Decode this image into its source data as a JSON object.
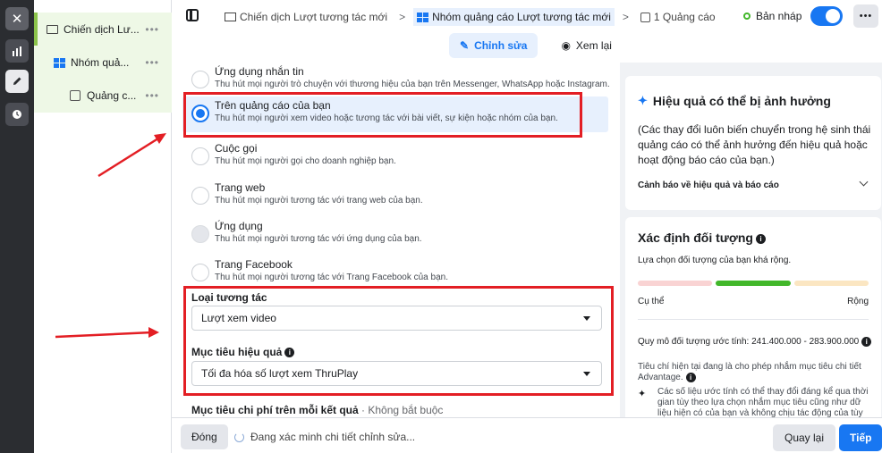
{
  "rail": {
    "close_glyph": "✕"
  },
  "tree": [
    {
      "label": "Chiến dịch Lư...",
      "more": "•••"
    },
    {
      "label": "Nhóm quả...",
      "more": "•••"
    },
    {
      "label": "Quảng c...",
      "more": "•••"
    }
  ],
  "header": {
    "crumbs": [
      "Chiến dịch Lượt tương tác mới",
      "Nhóm quảng cáo Lượt tương tác mới",
      "1 Quảng cáo"
    ],
    "separator": ">",
    "status": "Bản nháp",
    "more": "•••"
  },
  "tabs": [
    {
      "label": "Chỉnh sửa",
      "icon": "pencil-icon",
      "glyph": "✎"
    },
    {
      "label": "Xem lại",
      "icon": "eye-icon",
      "glyph": "◉"
    }
  ],
  "options": [
    {
      "title": "Ứng dụng nhắn tin",
      "desc": "Thu hút mọi người trò chuyện với thương hiệu của bạn trên Messenger, WhatsApp hoặc Instagram."
    },
    {
      "title": "Trên quảng cáo của bạn",
      "desc": "Thu hút mọi người xem video hoặc tương tác với bài viết, sự kiện hoặc nhóm của bạn."
    },
    {
      "title": "Cuộc gọi",
      "desc": "Thu hút mọi người gọi cho doanh nghiệp bạn."
    },
    {
      "title": "Trang web",
      "desc": "Thu hút mọi người tương tác với trang web của bạn."
    },
    {
      "title": "Ứng dụng",
      "desc": "Thu hút mọi người tương tác với ứng dụng của bạn."
    },
    {
      "title": "Trang Facebook",
      "desc": "Thu hút mọi người tương tác với Trang Facebook của bạn."
    }
  ],
  "form": {
    "engagement_label": "Loại tương tác",
    "engagement_value": "Lượt xem video",
    "goal_label": "Mục tiêu hiệu quả",
    "goal_value": "Tối đa hóa số lượt xem ThruPlay",
    "cost_label": "Mục tiêu chi phí trên mỗi kết quả",
    "cost_optional": " · Không bắt buộc"
  },
  "perf_card": {
    "title": "Hiệu quả có thể bị ảnh hưởng",
    "body": "(Các thay đổi luôn biến chuyển trong hệ sinh thái quảng cáo có thể ảnh hưởng đến hiệu quả hoặc hoạt động báo cáo của bạn.)",
    "link": "Cảnh báo về hiệu quả và báo cáo"
  },
  "audience_card": {
    "title": "Xác định đối tượng",
    "desc": "Lựa chọn đối tượng của bạn khá rộng.",
    "left_label": "Cụ thể",
    "right_label": "Rộng",
    "size": "Quy mô đối tượng ước tính: 241.400.000 - 283.900.000",
    "criteria": "Tiêu chí hiện tại đang là cho phép nhắm mục tiêu chi tiết Advantage.",
    "note": "Các số liệu ước tính có thể thay đổi đáng kể qua thời gian tùy theo lựa chọn nhắm mục tiêu cũng như dữ liệu hiện có của bạn và không chịu tác động của tùy",
    "meter_colors": [
      "#f9d3d3",
      "#42b72a",
      "#fbe6c2"
    ]
  },
  "footer": {
    "close": "Đóng",
    "status": "Đang xác minh chi tiết chỉnh sửa...",
    "back": "Quay lại",
    "next": "Tiếp"
  },
  "colors": {
    "accent": "#1877f2",
    "annotation": "#e31e24",
    "draft": "#42b72a"
  }
}
